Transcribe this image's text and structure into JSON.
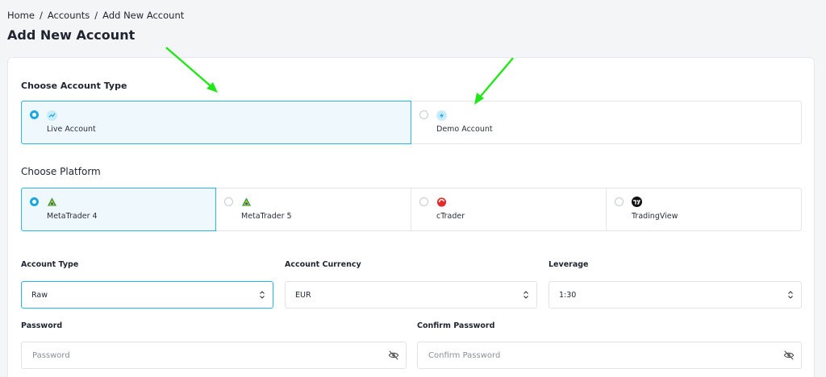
{
  "breadcrumb": {
    "home": "Home",
    "accounts": "Accounts",
    "current": "Add New Account",
    "sep": "/"
  },
  "page_title": "Add New Account",
  "account_type_section": {
    "label": "Choose Account Type",
    "options": [
      {
        "label": "Live Account",
        "selected": true,
        "icon": "live-icon"
      },
      {
        "label": "Demo Account",
        "selected": false,
        "icon": "demo-icon"
      }
    ]
  },
  "platform_section": {
    "label": "Choose Platform",
    "options": [
      {
        "label": "MetaTrader 4",
        "selected": true,
        "icon": "metatrader-4-icon"
      },
      {
        "label": "MetaTrader 5",
        "selected": false,
        "icon": "metatrader-5-icon"
      },
      {
        "label": "cTrader",
        "selected": false,
        "icon": "ctrader-icon"
      },
      {
        "label": "TradingView",
        "selected": false,
        "icon": "tradingview-icon"
      }
    ]
  },
  "form": {
    "account_type": {
      "label": "Account Type",
      "value": "Raw"
    },
    "account_currency": {
      "label": "Account Currency",
      "value": "EUR"
    },
    "leverage": {
      "label": "Leverage",
      "value": "1:30"
    },
    "password": {
      "label": "Password",
      "placeholder": "Password"
    },
    "confirm_password": {
      "label": "Confirm Password",
      "placeholder": "Confirm Password"
    }
  },
  "colors": {
    "accent": "#1ba7e0",
    "annotation_arrow": "#22e51a"
  }
}
